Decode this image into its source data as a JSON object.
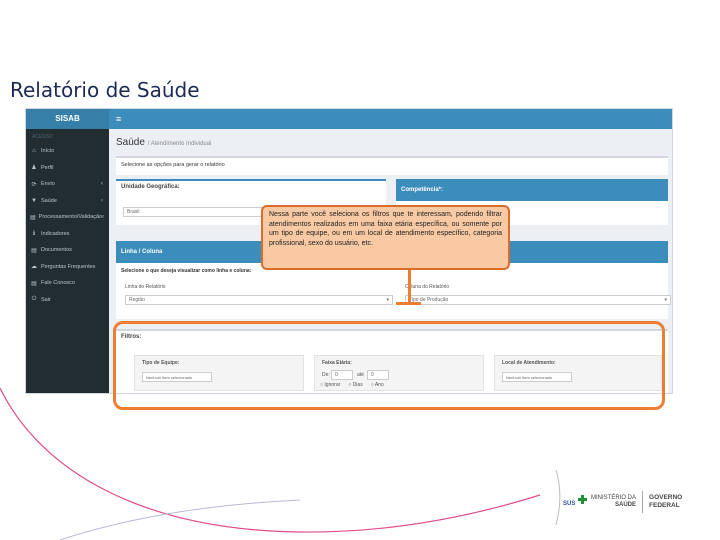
{
  "slide": {
    "title": "Relatório de Saúde"
  },
  "sidebar": {
    "logo": "SISAB",
    "section": "ACESSO",
    "items": [
      {
        "label": "Início",
        "icon": "home-icon",
        "glyph": "⌂",
        "chevron": ""
      },
      {
        "label": "Perfil",
        "icon": "user-icon",
        "glyph": "♟",
        "chevron": ""
      },
      {
        "label": "Envio",
        "icon": "upload-icon",
        "glyph": "⟳",
        "chevron": "‹"
      },
      {
        "label": "Saúde",
        "icon": "filter-icon",
        "glyph": "▼",
        "chevron": "‹"
      },
      {
        "label": "Processamento/Validação",
        "icon": "report-icon",
        "glyph": "▤",
        "chevron": "‹"
      },
      {
        "label": "Indicadores",
        "icon": "info-icon",
        "glyph": "ℹ",
        "chevron": ""
      },
      {
        "label": "Documentos",
        "icon": "document-icon",
        "glyph": "▤",
        "chevron": ""
      },
      {
        "label": "Perguntas Frequentes",
        "icon": "question-icon",
        "glyph": "☁",
        "chevron": ""
      },
      {
        "label": "Fale Conosco",
        "icon": "contact-icon",
        "glyph": "▤",
        "chevron": ""
      },
      {
        "label": "Sair",
        "icon": "power-icon",
        "glyph": "⏻",
        "chevron": ""
      }
    ]
  },
  "topbar": {
    "menu_glyph": "≡"
  },
  "page": {
    "title": "Saúde",
    "subtitle": "/ Atendimento Individual",
    "hint": "Selecione as opções para gerar o relatório"
  },
  "unidade": {
    "title": "Unidade Geográfica:",
    "value": "Brasil"
  },
  "competencia": {
    "title": "Competência*:"
  },
  "linha_coluna": {
    "title": "Linha / Coluna",
    "hint": "Selecione o que deseja visualizar como linha e coluna:",
    "linha_label": "Linha do Relatório",
    "linha_value": "Região",
    "coluna_label": "Coluna do Relatório",
    "coluna_value": "Tipo de Produção"
  },
  "filtros": {
    "title": "Filtros:",
    "tipo_equipe_label": "Tipo de Equipe:",
    "tipo_equipe_value": "Nenhum item selecionado",
    "faixa_label": "Faixa Etária:",
    "de_label": "De:",
    "de_value": "0",
    "ate_label": "até",
    "ate_value": "0",
    "radios": [
      "Ignorar",
      "Dias",
      "Ano"
    ],
    "local_label": "Local de Atendimento:",
    "local_value": "Nenhum item selecionado"
  },
  "callout": {
    "text": "Nessa parte você seleciona os filtros que te interessam, podendo filtrar atendimentos realizados em uma faixa etária específica, ou somente por um tipo de equipe, ou em um local de atendimento específico, categoria profissional, sexo do usuário, etc."
  },
  "logos": {
    "sus": "SUS",
    "ministerio_line1": "MINISTÉRIO DA",
    "ministerio_line2": "SAÚDE",
    "governo_line1": "GOVERNO",
    "governo_line2": "FEDERAL"
  },
  "colors": {
    "sidebar": "#222d32",
    "topbar": "#3c8dbc",
    "highlight": "#ed7d31",
    "callout_fill": "#f8c9a3"
  }
}
